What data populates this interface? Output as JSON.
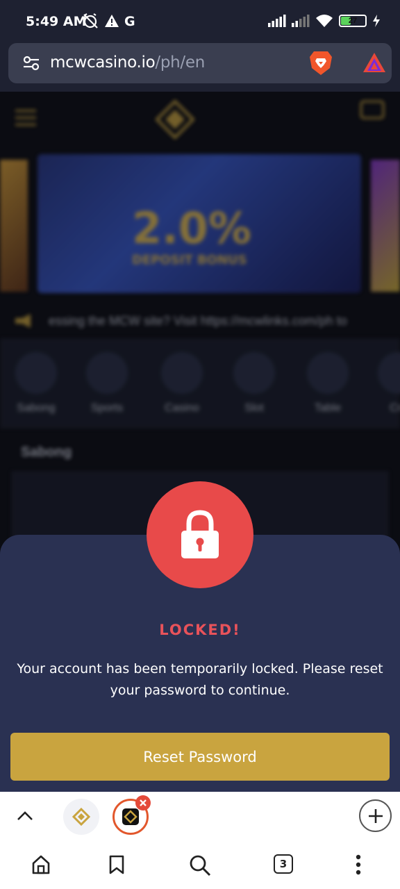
{
  "status_bar": {
    "time": "5:49 AM",
    "battery": "27",
    "icons": [
      "muted-alarm-icon",
      "warning-icon",
      "google-icon",
      "signal-icon",
      "signal-icon",
      "wifi-icon",
      "battery-icon",
      "charging-icon"
    ]
  },
  "address_bar": {
    "domain": "mcwcasino.io",
    "path": "/ph/en"
  },
  "background_page": {
    "banner_headline": "2.0%",
    "banner_sub": "DEPOSIT BONUS",
    "marquee": "essing the MCW site? Visit https://mcwlinks.com/ph to",
    "categories": [
      "Sabong",
      "Sports",
      "Casino",
      "Slot",
      "Table",
      "Cra"
    ],
    "section_title": "Sabong"
  },
  "modal": {
    "title": "LOCKED!",
    "message": "Your account has been temporarily locked. Please reset your password to continue.",
    "button_label": "Reset Password"
  },
  "tab_strip": {
    "open_tabs_count": "3"
  },
  "colors": {
    "modal_bg": "#2a3152",
    "lock_red": "#e84a4a",
    "title_red": "#e8525a",
    "button_gold": "#c9a43f",
    "browser_dark": "#1e2131"
  }
}
